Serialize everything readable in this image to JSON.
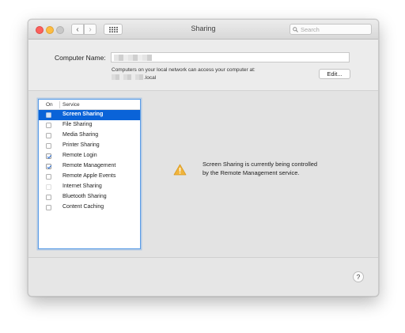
{
  "window": {
    "title": "Sharing",
    "search_placeholder": "Search",
    "nav_back": "‹",
    "nav_forward": "›"
  },
  "computer_name": {
    "label": "Computer Name:",
    "info_line1": "Computers on your local network can access your computer at:",
    "info_line2_suffix": ".local",
    "edit_label": "Edit..."
  },
  "services": {
    "header_on": "On",
    "header_service": "Service",
    "items": [
      {
        "label": "Screen Sharing",
        "checked": false,
        "selected": true,
        "enabled": true
      },
      {
        "label": "File Sharing",
        "checked": false,
        "selected": false,
        "enabled": true
      },
      {
        "label": "Media Sharing",
        "checked": false,
        "selected": false,
        "enabled": true
      },
      {
        "label": "Printer Sharing",
        "checked": false,
        "selected": false,
        "enabled": true
      },
      {
        "label": "Remote Login",
        "checked": true,
        "selected": false,
        "enabled": true
      },
      {
        "label": "Remote Management",
        "checked": true,
        "selected": false,
        "enabled": true
      },
      {
        "label": "Remote Apple Events",
        "checked": false,
        "selected": false,
        "enabled": true
      },
      {
        "label": "Internet Sharing",
        "checked": false,
        "selected": false,
        "enabled": false
      },
      {
        "label": "Bluetooth Sharing",
        "checked": false,
        "selected": false,
        "enabled": true
      },
      {
        "label": "Content Caching",
        "checked": false,
        "selected": false,
        "enabled": true
      }
    ]
  },
  "detail": {
    "message_line1": "Screen Sharing is currently being controlled",
    "message_line2": "by the Remote Management service.",
    "icon": "warning-icon",
    "warning_color": "#f0b43c"
  },
  "help_label": "?"
}
